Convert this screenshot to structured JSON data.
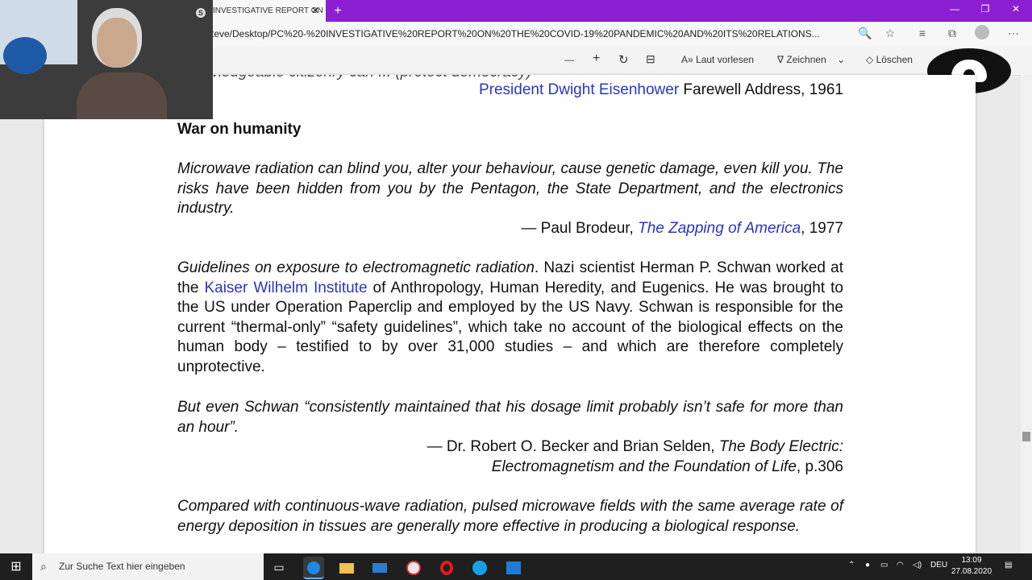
{
  "browser": {
    "tab_title": "INVESTIGATIVE REPORT ON",
    "tab_close": "✕",
    "new_tab": "+",
    "url": "teve/Desktop/PC%20-%20INVESTIGATIVE%20REPORT%20ON%20THE%20COVID-19%20PANDEMIC%20AND%20ITS%20RELATIONS...",
    "window_controls": [
      "—",
      "❐",
      "✕"
    ]
  },
  "pdf_toolbar": {
    "zoom_out": "—",
    "zoom_in": "+",
    "read_aloud": "Laut vorlesen",
    "draw": "Zeichnen",
    "erase": "Löschen"
  },
  "document": {
    "top_cut_line": "...nowledgeable citizenry can ... (protect democracy)",
    "eisenhower_link": "President Dwight Eisenhower",
    "eisenhower_rest": " Farewell Address, 1961",
    "heading": "War on humanity",
    "quote1": "Microwave radiation can blind you, alter your behaviour, cause genetic damage, even kill you. The risks have been hidden from you by the Pentagon, the State Department, and the electronics industry.",
    "attr1_pre": "— Paul Brodeur, ",
    "attr1_link": "The Zapping of America",
    "attr1_post": ", 1977",
    "para1_italic": "Guidelines on exposure to electromagnetic radiation",
    "para1_a": ". Nazi scientist Herman P. Schwan worked at the ",
    "para1_link": "Kaiser Wilhelm Institute",
    "para1_b": " of Anthropology, Human Heredity, and Eugenics. He was brought to the US under Operation Paperclip and employed by the US Navy. Schwan is responsible for the current “thermal-only” “safety guidelines”, which take no account of the biological effects on the human body – testified to by over 31,000 studies – and which are therefore completely unprotective.",
    "quote2": "But even Schwan “consistently maintained that his dosage limit probably isn’t safe for more than an hour”.",
    "attr2_pre": "— Dr. Robert O. Becker and Brian Selden, ",
    "attr2_title1": "The Body Electric:",
    "attr2_title2": "Electromagnetism and the Foundation of Life",
    "attr2_post": ", p.306",
    "quote3": "Compared with continuous-wave radiation, pulsed microwave fields with the same average rate of energy deposition in tissues are generally more effective in producing a biological response."
  },
  "taskbar": {
    "search_placeholder": "Zur Suche Text hier eingeben",
    "language": "DEU",
    "time": "13:09",
    "date": "27.08.2020"
  },
  "colors": {
    "titlebar": "#8b1fd1",
    "link": "#2a34c4"
  }
}
